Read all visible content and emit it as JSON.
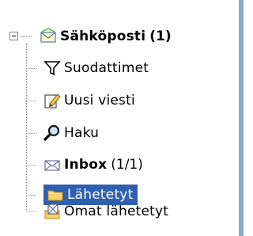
{
  "tree": {
    "root": {
      "label": "Sähköposti",
      "count": "(1)",
      "icon": "mail-envelope-open-icon"
    },
    "items": [
      {
        "label": "Suodattimet",
        "icon": "filter-icon"
      },
      {
        "label": "Uusi viesti",
        "icon": "compose-icon"
      },
      {
        "label": "Haku",
        "icon": "magnifier-icon"
      },
      {
        "label": "Inbox",
        "count": "(1/1)",
        "icon": "envelope-icon"
      },
      {
        "label": "Lähetetyt",
        "icon": "folder-icon"
      },
      {
        "label": "Omat lähetetyt",
        "icon": "sent-items-icon"
      }
    ]
  },
  "colors": {
    "selection": "#2f5faf",
    "right_edge": "#8aa8cc",
    "connector": "#7f7f7f"
  }
}
